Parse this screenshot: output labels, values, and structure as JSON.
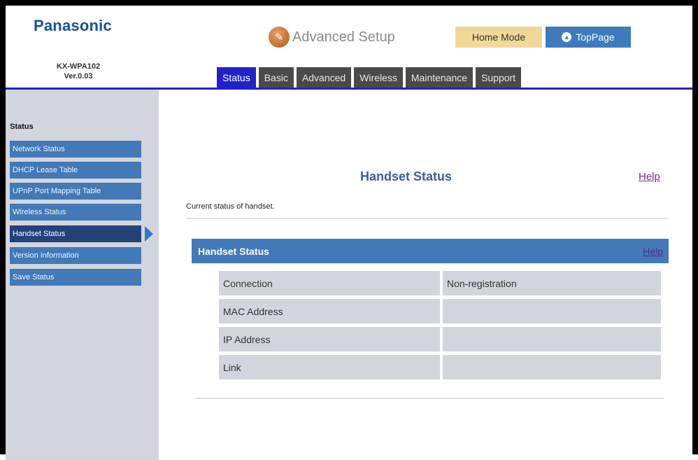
{
  "header": {
    "brand": "Panasonic",
    "model_line1": "KX-WPA102",
    "model_line2": "Ver.0.03",
    "title": "Advanced Setup",
    "home_mode_label": "Home Mode",
    "toppage_label": "TopPage"
  },
  "tabs": [
    {
      "label": "Status",
      "active": true
    },
    {
      "label": "Basic",
      "active": false
    },
    {
      "label": "Advanced",
      "active": false
    },
    {
      "label": "Wireless",
      "active": false
    },
    {
      "label": "Maintenance",
      "active": false
    },
    {
      "label": "Support",
      "active": false
    }
  ],
  "sidebar": {
    "heading": "Status",
    "items": [
      {
        "label": "Network Status",
        "active": false
      },
      {
        "label": "DHCP Lease Table",
        "active": false
      },
      {
        "label": "UPnP Port Mapping Table",
        "active": false
      },
      {
        "label": "Wireless Status",
        "active": false
      },
      {
        "label": "Handset Status",
        "active": true
      },
      {
        "label": "Version Information",
        "active": false
      },
      {
        "label": "Save Status",
        "active": false
      }
    ]
  },
  "main": {
    "page_title": "Handset Status",
    "help_label": "Help",
    "subtitle": "Current status of handset.",
    "section": {
      "title": "Handset Status",
      "help_label": "Help"
    },
    "table": {
      "rows": [
        {
          "label": "Connection",
          "value": "Non-registration"
        },
        {
          "label": "MAC Address",
          "value": ""
        },
        {
          "label": "IP Address",
          "value": ""
        },
        {
          "label": "Link",
          "value": ""
        }
      ]
    }
  },
  "colors": {
    "accent_blue": "#4279b8",
    "active_tab": "#2222cc",
    "active_sidebar": "#24417a",
    "home_mode_bg": "#f0d896"
  }
}
